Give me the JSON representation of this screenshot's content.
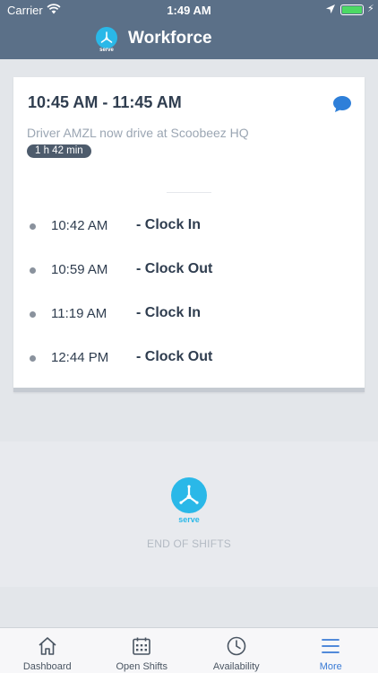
{
  "status_bar": {
    "carrier": "Carrier",
    "time": "1:49 AM",
    "battery_level": 1.0,
    "battery_color": "#4cd964"
  },
  "header": {
    "logo_text": "serve",
    "title": "Workforce",
    "background": "#5b7088"
  },
  "shift": {
    "time_range": "10:45 AM - 11:45 AM",
    "description": "Driver AMZL now drive at Scoobeez HQ",
    "duration": "1 h 42 min",
    "chat_icon": "chat-bubble-icon",
    "events": [
      {
        "time": "10:42 AM",
        "action": "- Clock In"
      },
      {
        "time": "10:59 AM",
        "action": "- Clock Out"
      },
      {
        "time": "11:19 AM",
        "action": "- Clock In"
      },
      {
        "time": "12:44 PM",
        "action": "- Clock Out"
      }
    ]
  },
  "end_section": {
    "logo_text": "serve",
    "label": "END OF SHIFTS",
    "brand_color": "#2ab8e8"
  },
  "tabs": [
    {
      "label": "Dashboard",
      "icon": "home-icon",
      "active": false
    },
    {
      "label": "Open Shifts",
      "icon": "calendar-icon",
      "active": false
    },
    {
      "label": "Availability",
      "icon": "clock-icon",
      "active": false
    },
    {
      "label": "More",
      "icon": "menu-icon",
      "active": true
    }
  ],
  "colors": {
    "accent": "#3a7bd5",
    "text_dark": "#2f3d4f",
    "badge": "#4d5b6c"
  }
}
